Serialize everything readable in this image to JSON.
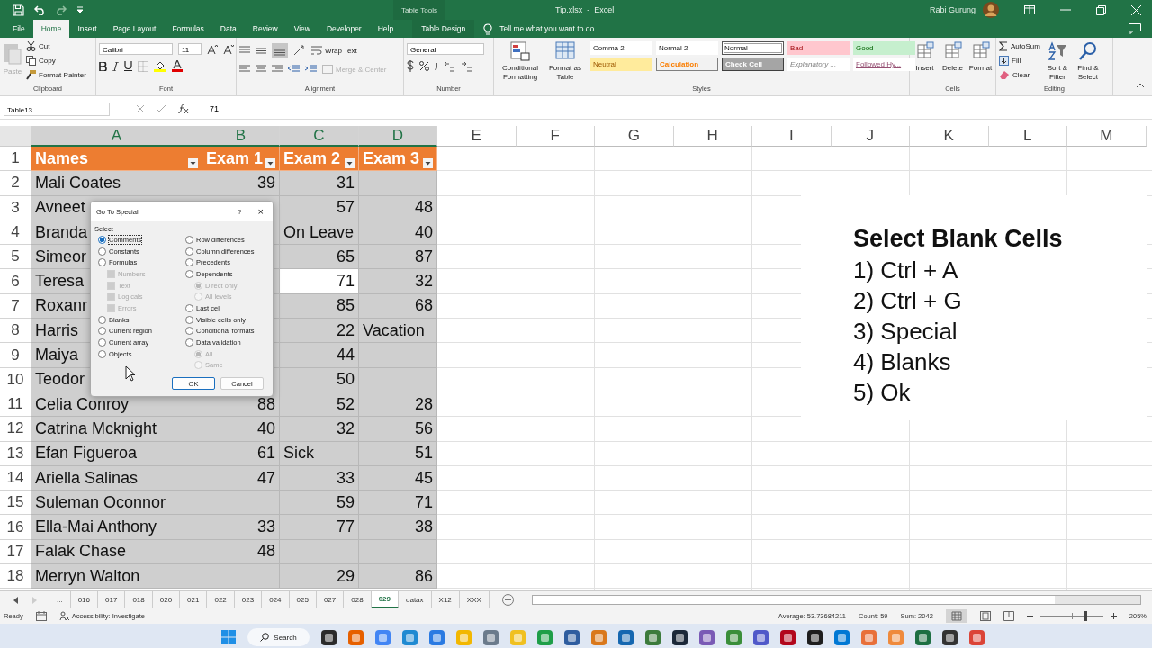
{
  "title_bar": {
    "context_label": "Table Tools",
    "title": "Tip.xlsx  -  Excel",
    "user": "Rabi Gurung"
  },
  "tabs": [
    {
      "label": "File",
      "selected": false,
      "kind": "standard"
    },
    {
      "label": "Home",
      "selected": true,
      "kind": "standard"
    },
    {
      "label": "Insert",
      "selected": false,
      "kind": "standard"
    },
    {
      "label": "Page Layout",
      "selected": false,
      "kind": "standard"
    },
    {
      "label": "Formulas",
      "selected": false,
      "kind": "standard"
    },
    {
      "label": "Data",
      "selected": false,
      "kind": "standard"
    },
    {
      "label": "Review",
      "selected": false,
      "kind": "standard"
    },
    {
      "label": "View",
      "selected": false,
      "kind": "standard"
    },
    {
      "label": "Developer",
      "selected": false,
      "kind": "standard"
    },
    {
      "label": "Help",
      "selected": false,
      "kind": "standard"
    },
    {
      "label": "Table Design",
      "selected": false,
      "kind": "contextual"
    }
  ],
  "tell_me": "Tell me what you want to do",
  "ribbon": {
    "clipboard": {
      "label": "Clipboard",
      "paste": "Paste",
      "cut": "Cut",
      "copy": "Copy",
      "format_painter": "Format Painter"
    },
    "font": {
      "label": "Font",
      "font_name": "Calibri",
      "font_size": "11"
    },
    "alignment": {
      "label": "Alignment",
      "wrap_text": "Wrap Text",
      "merge_center": "Merge & Center"
    },
    "number": {
      "label": "Number",
      "format": "General"
    },
    "styles": {
      "label": "Styles",
      "conditional": "Conditional Formatting",
      "format_table": "Format as Table",
      "gallery": [
        {
          "label": "Comma 2",
          "kind": "plain",
          "selected": false
        },
        {
          "label": "Normal 2",
          "kind": "plain",
          "selected": false
        },
        {
          "label": "Normal",
          "kind": "plain",
          "selected": true
        },
        {
          "label": "Bad",
          "kind": "bad",
          "selected": false
        },
        {
          "label": "Good",
          "kind": "good",
          "selected": false
        },
        {
          "label": "Neutral",
          "kind": "neutral",
          "selected": false
        },
        {
          "label": "Calculation",
          "kind": "calculation",
          "selected": false
        },
        {
          "label": "Check Cell",
          "kind": "check",
          "selected": false
        },
        {
          "label": "Explanatory ...",
          "kind": "explanatory",
          "selected": false
        },
        {
          "label": "Followed Hy...",
          "kind": "hyperlink",
          "selected": false
        }
      ]
    },
    "cells": {
      "label": "Cells",
      "buttons": [
        "Insert",
        "Delete",
        "Format"
      ]
    },
    "editing": {
      "label": "Editing",
      "autosum": "AutoSum",
      "fill": "Fill",
      "clear": "Clear",
      "sort_filter": "Sort & Filter",
      "find_select": "Find & Select"
    }
  },
  "formula_bar": {
    "name_box": "Table13",
    "formula": "71"
  },
  "sheet": {
    "column_letters": [
      {
        "label": "A",
        "selected": true
      },
      {
        "label": "B",
        "selected": true
      },
      {
        "label": "C",
        "selected": true
      },
      {
        "label": "D",
        "selected": true
      },
      {
        "label": "E",
        "selected": false
      },
      {
        "label": "F",
        "selected": false
      },
      {
        "label": "G",
        "selected": false
      },
      {
        "label": "H",
        "selected": false
      },
      {
        "label": "I",
        "selected": false
      },
      {
        "label": "J",
        "selected": false
      },
      {
        "label": "K",
        "selected": false
      },
      {
        "label": "L",
        "selected": false
      },
      {
        "label": "M",
        "selected": false
      }
    ],
    "table": {
      "header_row_number": "1",
      "columns": [
        "Names",
        "Exam 1",
        "Exam 2",
        "Exam 3"
      ],
      "rows": [
        {
          "number": "2",
          "cells": [
            {
              "text": "Mali Coates",
              "active": false
            },
            {
              "text": "39",
              "active": false
            },
            {
              "text": "31",
              "active": false
            },
            {
              "active": false
            }
          ]
        },
        {
          "number": "3",
          "cells": [
            {
              "text": "Avneet",
              "active": false
            },
            {
              "active": false
            },
            {
              "text": "57",
              "active": false
            },
            {
              "text": "48",
              "active": false
            }
          ]
        },
        {
          "number": "4",
          "cells": [
            {
              "text": "Branda",
              "active": false
            },
            {
              "active": false
            },
            {
              "text": "On Leave",
              "active": false
            },
            {
              "text": "40",
              "active": false
            }
          ]
        },
        {
          "number": "5",
          "cells": [
            {
              "text": "Simeor",
              "active": false
            },
            {
              "active": false
            },
            {
              "text": "65",
              "active": false
            },
            {
              "text": "87",
              "active": false
            }
          ]
        },
        {
          "number": "6",
          "cells": [
            {
              "text": "Teresa",
              "active": false
            },
            {
              "active": false
            },
            {
              "text": "71",
              "active": true
            },
            {
              "text": "32",
              "active": false
            }
          ]
        },
        {
          "number": "7",
          "cells": [
            {
              "text": "Roxanr",
              "active": false
            },
            {
              "active": false
            },
            {
              "text": "85",
              "active": false
            },
            {
              "text": "68",
              "active": false
            }
          ]
        },
        {
          "number": "8",
          "cells": [
            {
              "text": "Harris",
              "active": false
            },
            {
              "active": false
            },
            {
              "text": "22",
              "active": false
            },
            {
              "text": "Vacation",
              "active": false
            }
          ]
        },
        {
          "number": "9",
          "cells": [
            {
              "text": "Maiya",
              "active": false
            },
            {
              "active": false
            },
            {
              "text": "44",
              "active": false
            },
            {
              "active": false
            }
          ]
        },
        {
          "number": "10",
          "cells": [
            {
              "text": "Teodor",
              "active": false
            },
            {
              "active": false
            },
            {
              "text": "50",
              "active": false
            },
            {
              "active": false
            }
          ]
        },
        {
          "number": "11",
          "cells": [
            {
              "text": "Celia Conroy",
              "active": false
            },
            {
              "text": "88",
              "active": false
            },
            {
              "text": "52",
              "active": false
            },
            {
              "text": "28",
              "active": false
            }
          ]
        },
        {
          "number": "12",
          "cells": [
            {
              "text": "Catrina Mcknight",
              "active": false
            },
            {
              "text": "40",
              "active": false
            },
            {
              "text": "32",
              "active": false
            },
            {
              "text": "56",
              "active": false
            }
          ]
        },
        {
          "number": "13",
          "cells": [
            {
              "text": "Efan Figueroa",
              "active": false
            },
            {
              "text": "61",
              "active": false
            },
            {
              "text": "Sick",
              "active": false
            },
            {
              "text": "51",
              "active": false
            }
          ]
        },
        {
          "number": "14",
          "cells": [
            {
              "text": "Ariella Salinas",
              "active": false
            },
            {
              "text": "47",
              "active": false
            },
            {
              "text": "33",
              "active": false
            },
            {
              "text": "45",
              "active": false
            }
          ]
        },
        {
          "number": "15",
          "cells": [
            {
              "text": "Suleman Oconnor",
              "active": false
            },
            {
              "active": false
            },
            {
              "text": "59",
              "active": false
            },
            {
              "text": "71",
              "active": false
            }
          ]
        },
        {
          "number": "16",
          "cells": [
            {
              "text": "Ella-Mai Anthony",
              "active": false
            },
            {
              "text": "33",
              "active": false
            },
            {
              "text": "77",
              "active": false
            },
            {
              "text": "38",
              "active": false
            }
          ]
        },
        {
          "number": "17",
          "cells": [
            {
              "text": "Falak Chase",
              "active": false
            },
            {
              "text": "48",
              "active": false
            },
            {
              "active": false
            },
            {
              "active": false
            }
          ]
        },
        {
          "number": "18",
          "cells": [
            {
              "text": "Merryn Walton",
              "active": false
            },
            {
              "active": false
            },
            {
              "text": "29",
              "active": false
            },
            {
              "text": "86",
              "active": false
            }
          ]
        }
      ]
    }
  },
  "note": {
    "title": "Select Blank Cells",
    "steps": [
      "1) Ctrl + A",
      "2) Ctrl + G",
      "3) Special",
      "4) Blanks",
      "5) Ok"
    ]
  },
  "dialog": {
    "title": "Go To Special",
    "help": "?",
    "close": "×",
    "group_label": "Select",
    "left_options": [
      {
        "label": "Comments",
        "kind": "radio",
        "selected": true,
        "disabled": false
      },
      {
        "label": "Constants",
        "kind": "radio",
        "selected": false,
        "disabled": false
      },
      {
        "label": "Formulas",
        "kind": "radio",
        "selected": false,
        "disabled": false,
        "children": [
          {
            "label": "Numbers",
            "kind": "checkbox",
            "checked": true,
            "disabled": true
          },
          {
            "label": "Text",
            "kind": "checkbox",
            "checked": true,
            "disabled": true
          },
          {
            "label": "Logicals",
            "kind": "checkbox",
            "checked": true,
            "disabled": true
          },
          {
            "label": "Errors",
            "kind": "checkbox",
            "checked": true,
            "disabled": true
          }
        ]
      },
      {
        "label": "Blanks",
        "kind": "radio",
        "selected": false,
        "disabled": false
      },
      {
        "label": "Current region",
        "kind": "radio",
        "selected": false,
        "disabled": false
      },
      {
        "label": "Current array",
        "kind": "radio",
        "selected": false,
        "disabled": false
      },
      {
        "label": "Objects",
        "kind": "radio",
        "selected": false,
        "disabled": false
      }
    ],
    "right_options": [
      {
        "label": "Row differences",
        "kind": "radio",
        "selected": false,
        "disabled": false
      },
      {
        "label": "Column differences",
        "kind": "radio",
        "selected": false,
        "disabled": false
      },
      {
        "label": "Precedents",
        "kind": "radio",
        "selected": false,
        "disabled": false
      },
      {
        "label": "Dependents",
        "kind": "radio",
        "selected": false,
        "disabled": false,
        "children": [
          {
            "label": "Direct only",
            "kind": "radio",
            "selected": true,
            "disabled": true
          },
          {
            "label": "All levels",
            "kind": "radio",
            "selected": false,
            "disabled": true
          }
        ]
      },
      {
        "label": "Last cell",
        "kind": "radio",
        "selected": false,
        "disabled": false
      },
      {
        "label": "Visible cells only",
        "kind": "radio",
        "selected": false,
        "disabled": false
      },
      {
        "label": "Conditional formats",
        "kind": "radio",
        "selected": false,
        "disabled": false
      },
      {
        "label": "Data validation",
        "kind": "radio",
        "selected": false,
        "disabled": false,
        "children": [
          {
            "label": "All",
            "kind": "radio",
            "selected": true,
            "disabled": true
          },
          {
            "label": "Same",
            "kind": "radio",
            "selected": false,
            "disabled": true
          }
        ]
      }
    ],
    "ok": "OK",
    "cancel": "Cancel"
  },
  "sheet_tabs": {
    "overflow": "...",
    "tabs": [
      {
        "label": "016",
        "selected": false
      },
      {
        "label": "017",
        "selected": false
      },
      {
        "label": "018",
        "selected": false
      },
      {
        "label": "020",
        "selected": false
      },
      {
        "label": "021",
        "selected": false
      },
      {
        "label": "022",
        "selected": false
      },
      {
        "label": "023",
        "selected": false
      },
      {
        "label": "024",
        "selected": false
      },
      {
        "label": "025",
        "selected": false
      },
      {
        "label": "027",
        "selected": false
      },
      {
        "label": "028",
        "selected": false
      },
      {
        "label": "029",
        "selected": true
      },
      {
        "label": "datax",
        "selected": false
      },
      {
        "label": "X12",
        "selected": false
      },
      {
        "label": "XXX",
        "selected": false
      }
    ]
  },
  "status_bar": {
    "mode": "Ready",
    "accessibility": "Accessibility: Investigate",
    "average": "Average: 53.73684211",
    "count": "Count: 59",
    "sum": "Sum: 2042",
    "zoom": "205%",
    "zoom_slider": {
      "level": 0.72
    }
  },
  "taskbar": {
    "search": "Search"
  }
}
